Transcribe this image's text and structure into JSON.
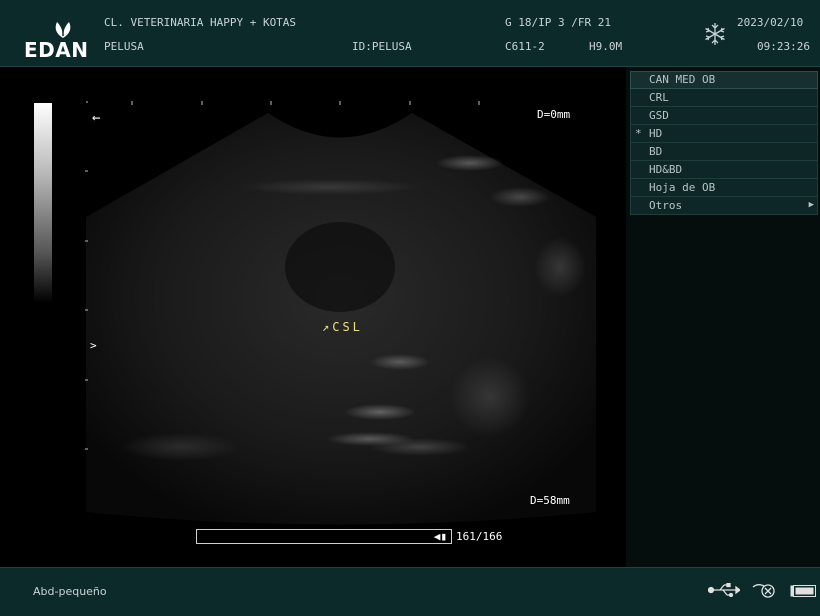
{
  "header": {
    "brand": "EDAN",
    "clinic": "CL. VETERINARIA HAPPY + KOTAS",
    "patient": "PELUSA",
    "patient_id": "ID:PELUSA",
    "params_line1": "G 18/IP 3 /FR 21",
    "probe": "C611-2",
    "frequency": "H9.0M",
    "date": "2023/02/10",
    "time": "09:23:26"
  },
  "image": {
    "depth_top": "D=0mm",
    "depth_bottom": "D=58mm",
    "annotation": "↗CSL",
    "direction_arrow": "←",
    "focus_marker": ">",
    "cine_counter": "161/166",
    "cine_position": 0.97
  },
  "menu": {
    "title": "CAN MED OB",
    "items": [
      {
        "label": "CRL",
        "marker": ""
      },
      {
        "label": "GSD",
        "marker": ""
      },
      {
        "label": "HD",
        "marker": "*"
      },
      {
        "label": "BD",
        "marker": ""
      },
      {
        "label": "HD&BD",
        "marker": ""
      },
      {
        "label": "Hoja de OB",
        "marker": ""
      },
      {
        "label": "Otros",
        "marker": "",
        "has_submenu": true
      }
    ]
  },
  "footer": {
    "exam_mode": "Abd-pequeño",
    "icons": [
      "usb-icon",
      "probe-icon",
      "battery-icon"
    ]
  },
  "colors": {
    "header_bg": "#0c2a2a",
    "annotation": "#e8e07a"
  }
}
